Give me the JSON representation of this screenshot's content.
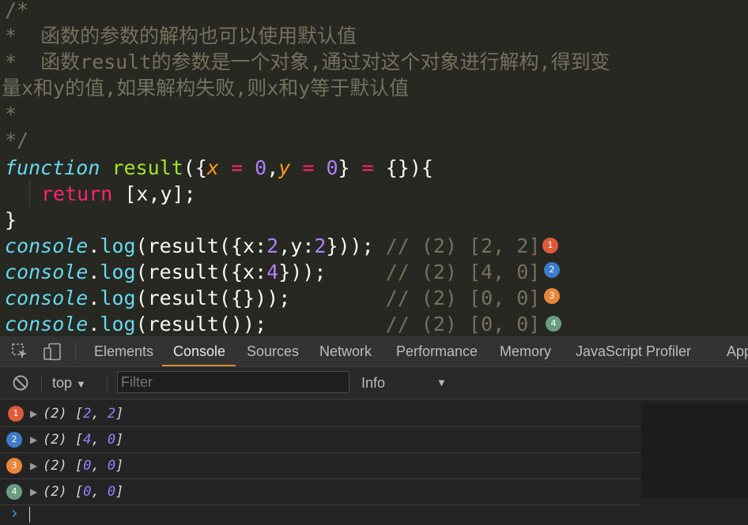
{
  "editor": {
    "comment_lines": [
      "/*",
      "*  函数的参数的解构也可以使用默认值",
      "*  函数result的参数是一个对象,通过对这个对象进行解构,得到变",
      "量x和y的值,如果解构失败,则x和y等于默认值",
      "*",
      "*/"
    ],
    "fn": {
      "keyword": "function",
      "name": "result",
      "open": "({",
      "param_x": "x",
      "eq1": " = ",
      "val_x": "0",
      "comma": ",",
      "param_y": "y",
      "eq2": " = ",
      "val_y": "0",
      "close_obj": "}",
      "eq3": " = ",
      "default": "{}){"
    },
    "return_line": {
      "keyword": "return",
      "rest": " [x,y];"
    },
    "close_brace": "}",
    "log_lines": [
      {
        "obj": "console",
        "dot": ".",
        "method": "log",
        "code_pre": "(result({x:",
        "n1": "2",
        "code_mid": ",y:",
        "n2": "2",
        "code_post": "})); ",
        "comment": "// (2) [2, 2]",
        "badge": "1"
      },
      {
        "obj": "console",
        "dot": ".",
        "method": "log",
        "code_pre": "(result({x:",
        "n1": "4",
        "code_mid": "",
        "n2": "",
        "code_post": "}));     ",
        "comment": "// (2) [4, 0]",
        "badge": "2"
      },
      {
        "obj": "console",
        "dot": ".",
        "method": "log",
        "code_pre": "(result({}));        ",
        "n1": "",
        "code_mid": "",
        "n2": "",
        "code_post": "",
        "comment": "// (2) [0, 0]",
        "badge": "3"
      },
      {
        "obj": "console",
        "dot": ".",
        "method": "log",
        "code_pre": "(result());          ",
        "n1": "",
        "code_mid": "",
        "n2": "",
        "code_post": "",
        "comment": "// (2) [0, 0]",
        "badge": "4"
      }
    ]
  },
  "devtools": {
    "tabs": [
      "Elements",
      "Console",
      "Sources",
      "Network",
      "Performance",
      "Memory",
      "JavaScript Profiler",
      "App"
    ],
    "active_tab": "Console",
    "context": "top",
    "filter_placeholder": "Filter",
    "level": "Info",
    "console_rows": [
      {
        "badge": "1",
        "prefix": "(2) [",
        "a": "2",
        "sep": ", ",
        "b": "2",
        "suffix": "]"
      },
      {
        "badge": "2",
        "prefix": "(2) [",
        "a": "4",
        "sep": ", ",
        "b": "0",
        "suffix": "]"
      },
      {
        "badge": "3",
        "prefix": "(2) [",
        "a": "0",
        "sep": ", ",
        "b": "0",
        "suffix": "]"
      },
      {
        "badge": "4",
        "prefix": "(2) [",
        "a": "0",
        "sep": ", ",
        "b": "0",
        "suffix": "]"
      }
    ],
    "prompt": "›"
  },
  "colors": {
    "badges": [
      "#e05a3a",
      "#3d7cc9",
      "#e8863a",
      "#6a9c82"
    ],
    "accent": "#d88a35",
    "editor_bg": "#272822"
  }
}
